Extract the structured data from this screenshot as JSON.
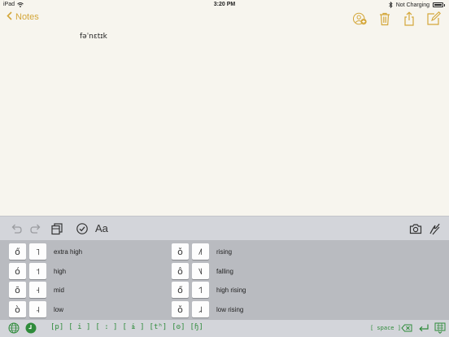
{
  "status_bar": {
    "device": "iPad",
    "wifi_icon": "wifi-icon",
    "time": "3:20 PM",
    "bluetooth_icon": "bluetooth-icon",
    "charging": "Not Charging",
    "battery_icon": "battery-icon"
  },
  "nav": {
    "back_label": "Notes",
    "accent": "#d4a73a",
    "icons": [
      "add-people-icon",
      "trash-icon",
      "share-icon",
      "compose-icon"
    ]
  },
  "note": {
    "text": "fəˈnɛtɪk"
  },
  "toolbar": {
    "undo_icon": "undo-icon",
    "redo_icon": "redo-icon",
    "table_icon": "table-icon",
    "checklist_icon": "checklist-icon",
    "format_label": "Aa",
    "camera_icon": "camera-icon",
    "sketch_icon": "sketch-icon"
  },
  "tones": {
    "left": [
      {
        "diacritic": "ő",
        "letter": "˥",
        "label": "extra high"
      },
      {
        "diacritic": "ó",
        "letter": "˦",
        "label": "high"
      },
      {
        "diacritic": "ō",
        "letter": "˧",
        "label": "mid"
      },
      {
        "diacritic": "ò",
        "letter": "˨",
        "label": "low"
      }
    ],
    "right": [
      {
        "diacritic": "ǒ",
        "letter": "˩˥",
        "label": "rising"
      },
      {
        "diacritic": "ô",
        "letter": "˥˩",
        "label": "falling"
      },
      {
        "diacritic": "ő",
        "letter": "˦˥",
        "label": "high rising"
      },
      {
        "diacritic": "ǒ",
        "letter": "˩˨",
        "label": "low rising"
      }
    ]
  },
  "bottom_bar": {
    "globe_icon": "globe-icon",
    "tone_icon": "tone-keyboard-icon",
    "ipa_buttons": [
      "[p]",
      "[ i ]",
      "[ : ]",
      "[ ɨ ]",
      "[tʰ]",
      "[ʘ]",
      "[ɧ]"
    ],
    "space_label": "[ space ]",
    "delete_icon": "delete-icon",
    "return_icon": "return-icon",
    "dismiss_icon": "keyboard-dismiss-icon",
    "ipa_color": "#2e8b3a"
  }
}
